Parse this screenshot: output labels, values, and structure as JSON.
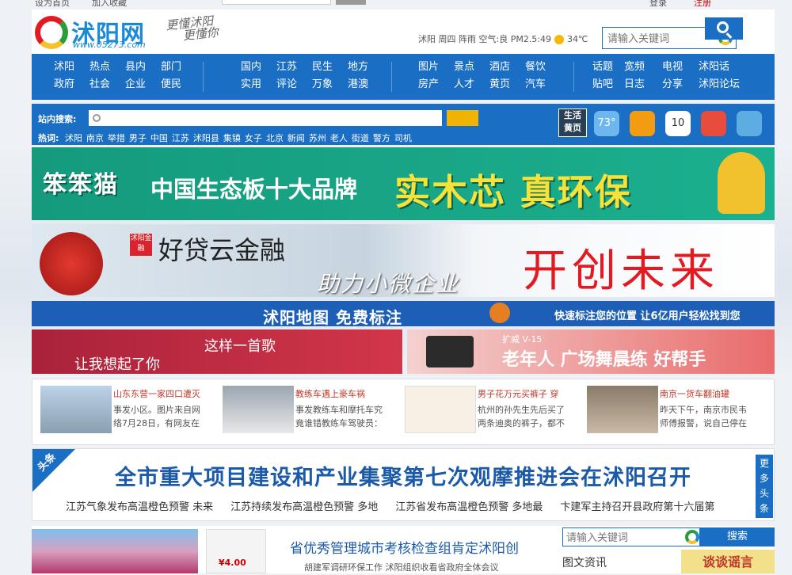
{
  "topbar": {
    "left1": "设为首页",
    "left2": "加入收藏",
    "right1": "登录",
    "right2": "注册"
  },
  "header": {
    "logo_text": "沭阳网",
    "logo_url": "www.05273.com",
    "slogan_line1": "更懂沭阳",
    "slogan_line2": "更懂你",
    "weather": "沭阳 周四 阵雨 空气:良 PM2.5:49",
    "temperature": "34℃",
    "search_placeholder": "请输入关键词"
  },
  "nav": {
    "groups": [
      [
        "沭阳",
        "热点",
        "县内",
        "部门",
        "政府",
        "社会",
        "企业",
        "便民"
      ],
      [
        "国内",
        "江苏",
        "民生",
        "地方",
        "实用",
        "评论",
        "万象",
        "港澳"
      ],
      [
        "图片",
        "景点",
        "酒店",
        "餐饮",
        "房产",
        "人才",
        "黄页",
        "汽车"
      ],
      [
        "话题",
        "宽频",
        "电视",
        "沭阳话",
        "贴吧",
        "日志",
        "分享",
        "沭阳论坛"
      ]
    ]
  },
  "site_search": {
    "label": "站内搜索:",
    "hot_label": "热词:",
    "hot_words": [
      "沭阳",
      "南京",
      "举措",
      "男子",
      "中国",
      "江苏",
      "沭阳县",
      "集镇",
      "女子",
      "北京",
      "新闻",
      "苏州",
      "老人",
      "街道",
      "警方",
      "司机"
    ],
    "yellow_page_line1": "生活",
    "yellow_page_line2": "黄页",
    "app_temp": "73°",
    "app_cal": "10"
  },
  "banners": {
    "b1_brand": "笨笨猫",
    "b1_text1": "中国生态板十大品牌",
    "b1_text2": "实木芯 真环保",
    "b2_logo": "沭阳金融",
    "b2_text1": "好贷云金融",
    "b2_text2": "开创未来",
    "b2_text3": "助力小微企业",
    "b3_text1": "沭阳地图 免费标注",
    "b3_text2": "快速标注您的位置 让6亿用户轻松找到您",
    "b4_text1": "这样一首歌",
    "b4_text2": "让我想起了你",
    "b5_text0": "扩威 V-15",
    "b5_text1": "老年人 广场舞晨练 好帮手"
  },
  "news_items": [
    {
      "title": "山东东营一家四口遭灭",
      "desc": "事发小区。图片来自网络7月28日，有网友在"
    },
    {
      "title": "教练车遇上豪车祸",
      "desc": "事发教练车和摩托车究竟谁错教练车驾驶员：我"
    },
    {
      "title": "男子花万元买裤子 穿",
      "desc": "杭州的孙先生先后买了两条迪奥的裤子，都不便"
    },
    {
      "title": "南京一货车翻油罐",
      "desc": "昨天下午，南京市民韦师傅报警，说自己停在浦"
    }
  ],
  "headline": {
    "tag": "头条",
    "title": "全市重大项目建设和产业集聚第七次观摩推进会在沭阳召开",
    "links": [
      "江苏气象发布高温橙色预警 未来",
      "江苏持续发布高温橙色预警 多地",
      "江苏省发布高温橙色预警 多地最",
      "卞建军主持召开县政府第十六届第"
    ],
    "more": "更多头条"
  },
  "bottom": {
    "price": "¥4.00",
    "title": "省优秀管理城市考核检查组肯定沭阳创",
    "desc": "胡建军调研环保工作 沭阳组织收看省政府全体会议",
    "search_placeholder": "请输入关键词",
    "search_button": "搜索",
    "tuwen": "图文资讯",
    "rumor": "谈谈谣言"
  }
}
